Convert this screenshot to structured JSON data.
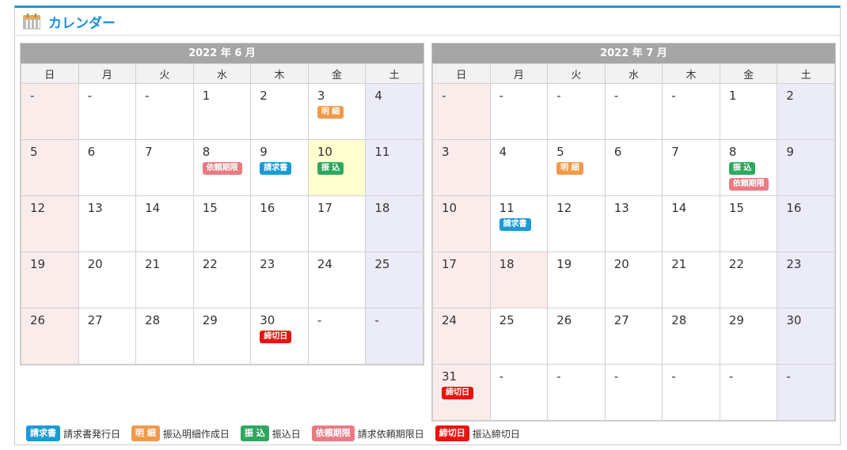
{
  "title": "カレンダー",
  "weekdays": [
    "日",
    "月",
    "火",
    "水",
    "木",
    "金",
    "土"
  ],
  "months": [
    {
      "label": "2022 年 6 月",
      "weeks": [
        [
          {
            "d": "-"
          },
          {
            "d": "-"
          },
          {
            "d": "-"
          },
          {
            "d": "1"
          },
          {
            "d": "2"
          },
          {
            "d": "3",
            "b": [
              {
                "t": "明 細",
                "c": "meisai"
              }
            ]
          },
          {
            "d": "4"
          }
        ],
        [
          {
            "d": "5"
          },
          {
            "d": "6"
          },
          {
            "d": "7"
          },
          {
            "d": "8",
            "b": [
              {
                "t": "依頼期限",
                "c": "irai"
              }
            ]
          },
          {
            "d": "9",
            "b": [
              {
                "t": "請求書",
                "c": "seikyu"
              }
            ]
          },
          {
            "d": "10",
            "today": true,
            "b": [
              {
                "t": "振 込",
                "c": "furikomi"
              }
            ]
          },
          {
            "d": "11"
          }
        ],
        [
          {
            "d": "12"
          },
          {
            "d": "13"
          },
          {
            "d": "14"
          },
          {
            "d": "15"
          },
          {
            "d": "16"
          },
          {
            "d": "17"
          },
          {
            "d": "18"
          }
        ],
        [
          {
            "d": "19"
          },
          {
            "d": "20"
          },
          {
            "d": "21"
          },
          {
            "d": "22"
          },
          {
            "d": "23"
          },
          {
            "d": "24"
          },
          {
            "d": "25"
          }
        ],
        [
          {
            "d": "26"
          },
          {
            "d": "27"
          },
          {
            "d": "28"
          },
          {
            "d": "29"
          },
          {
            "d": "30",
            "b": [
              {
                "t": "締切日",
                "c": "shime"
              }
            ]
          },
          {
            "d": "-"
          },
          {
            "d": "-"
          }
        ]
      ]
    },
    {
      "label": "2022 年 7 月",
      "weeks": [
        [
          {
            "d": "-"
          },
          {
            "d": "-"
          },
          {
            "d": "-"
          },
          {
            "d": "-"
          },
          {
            "d": "-"
          },
          {
            "d": "1"
          },
          {
            "d": "2"
          }
        ],
        [
          {
            "d": "3"
          },
          {
            "d": "4"
          },
          {
            "d": "5",
            "b": [
              {
                "t": "明 細",
                "c": "meisai"
              }
            ]
          },
          {
            "d": "6"
          },
          {
            "d": "7"
          },
          {
            "d": "8",
            "b": [
              {
                "t": "振 込",
                "c": "furikomi"
              },
              {
                "t": "依頼期限",
                "c": "irai"
              }
            ]
          },
          {
            "d": "9"
          }
        ],
        [
          {
            "d": "10"
          },
          {
            "d": "11",
            "b": [
              {
                "t": "請求書",
                "c": "seikyu"
              }
            ]
          },
          {
            "d": "12"
          },
          {
            "d": "13"
          },
          {
            "d": "14"
          },
          {
            "d": "15"
          },
          {
            "d": "16"
          }
        ],
        [
          {
            "d": "17"
          },
          {
            "d": "18",
            "holiday": true
          },
          {
            "d": "19"
          },
          {
            "d": "20"
          },
          {
            "d": "21"
          },
          {
            "d": "22"
          },
          {
            "d": "23"
          }
        ],
        [
          {
            "d": "24"
          },
          {
            "d": "25"
          },
          {
            "d": "26"
          },
          {
            "d": "27"
          },
          {
            "d": "28"
          },
          {
            "d": "29"
          },
          {
            "d": "30"
          }
        ],
        [
          {
            "d": "31",
            "b": [
              {
                "t": "締切日",
                "c": "shime"
              }
            ]
          },
          {
            "d": "-"
          },
          {
            "d": "-"
          },
          {
            "d": "-"
          },
          {
            "d": "-"
          },
          {
            "d": "-"
          },
          {
            "d": "-"
          }
        ]
      ]
    }
  ],
  "legend": [
    {
      "badge": "請求書",
      "c": "seikyu",
      "label": "請求書発行日"
    },
    {
      "badge": "明 細",
      "c": "meisai",
      "label": "振込明細作成日"
    },
    {
      "badge": "振 込",
      "c": "furikomi",
      "label": "振込日"
    },
    {
      "badge": "依頼期限",
      "c": "irai",
      "label": "請求依頼期限日"
    },
    {
      "badge": "締切日",
      "c": "shime",
      "label": "振込締切日"
    }
  ],
  "colors": {
    "accent": "#2196d8",
    "seikyu": "#1b9ad6",
    "meisai": "#f09a49",
    "furikomi": "#2fa85e",
    "irai": "#e87b84",
    "shime": "#e8150f"
  },
  "icon": "calendar-icon"
}
